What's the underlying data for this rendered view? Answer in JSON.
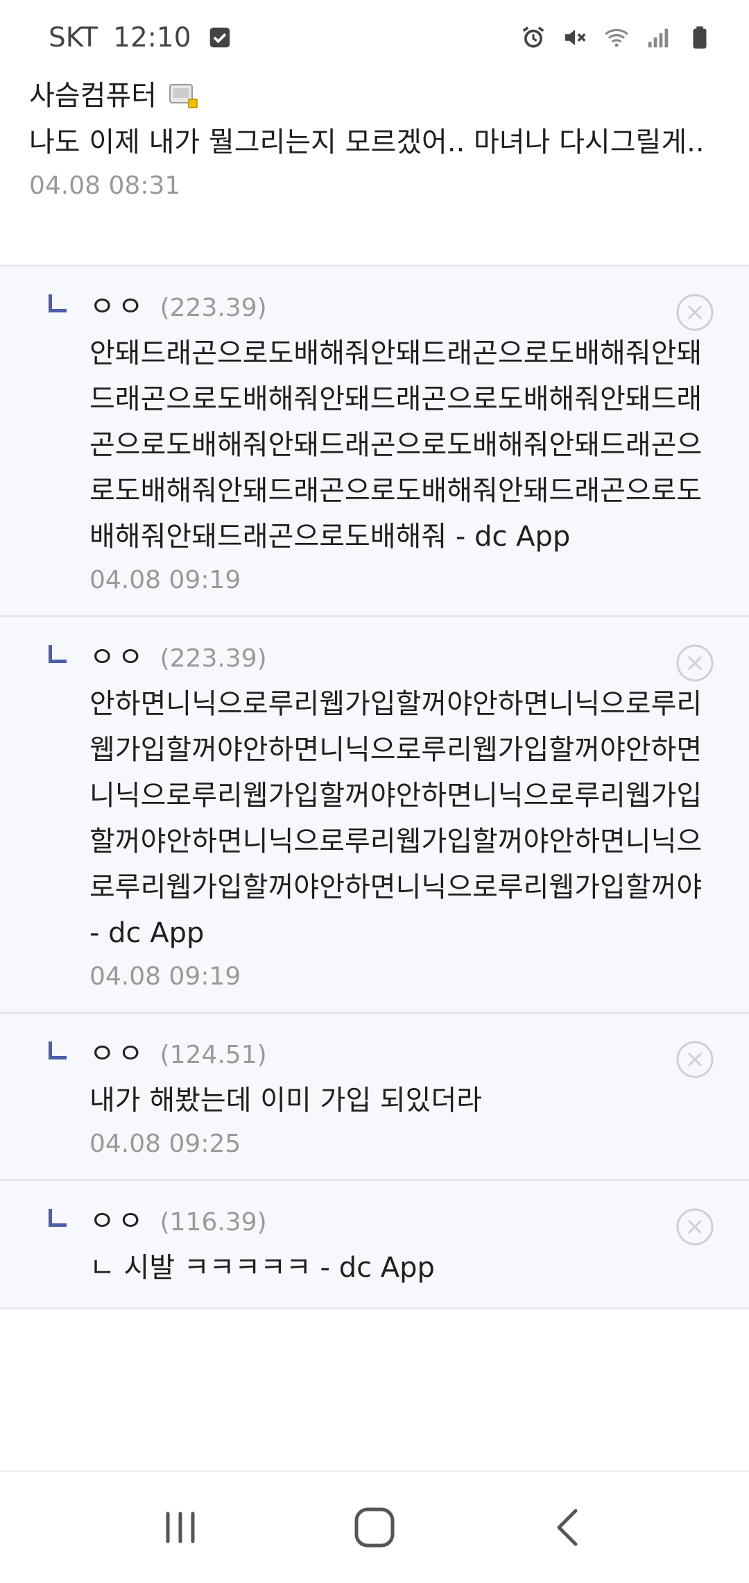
{
  "status_bar": {
    "carrier": "SKT",
    "time": "12:10",
    "icons": [
      "checkbox-icon",
      "alarm-icon",
      "mute-icon",
      "wifi-icon",
      "signal-icon",
      "battery-icon"
    ]
  },
  "post": {
    "author": "사슴컴퓨터",
    "body": "나도 이제 내가 뭘그리는지 모르겠어.. 마녀나 다시그릴게..",
    "time": "04.08 08:31"
  },
  "comments": [
    {
      "name": "ㅇㅇ",
      "ip": "(223.39)",
      "body": "안돼드래곤으로도배해줘안돼드래곤으로도배해줘안돼드래곤으로도배해줘안돼드래곤으로도배해줘안돼드래곤으로도배해줘안돼드래곤으로도배해줘안돼드래곤으로도배해줘안돼드래곤으로도배해줘안돼드래곤으로도배해줘안돼드래곤으로도배해줘 - dc App",
      "time": "04.08 09:19"
    },
    {
      "name": "ㅇㅇ",
      "ip": "(223.39)",
      "body": "안하면니닉으로루리웹가입할꺼야안하면니닉으로루리웹가입할꺼야안하면니닉으로루리웹가입할꺼야안하면니닉으로루리웹가입할꺼야안하면니닉으로루리웹가입할꺼야안하면니닉으로루리웹가입할꺼야안하면니닉으로루리웹가입할꺼야안하면니닉으로루리웹가입할꺼야 - dc App",
      "time": "04.08 09:19"
    },
    {
      "name": "ㅇㅇ",
      "ip": "(124.51)",
      "body": "내가 해봤는데 이미 가입 되있더라",
      "time": "04.08 09:25"
    },
    {
      "name": "ㅇㅇ",
      "ip": "(116.39)",
      "body": "ㄴ 시발 ㅋㅋㅋㅋㅋ - dc App",
      "time": ""
    }
  ],
  "nav_bar": {
    "icons": [
      "recent-apps-icon",
      "home-icon",
      "back-icon"
    ]
  },
  "colors": {
    "reply_marker": "#4d5fa8",
    "comment_bg": "#f7f8fb",
    "divider": "#e3e6ec",
    "meta_text": "#999999"
  }
}
